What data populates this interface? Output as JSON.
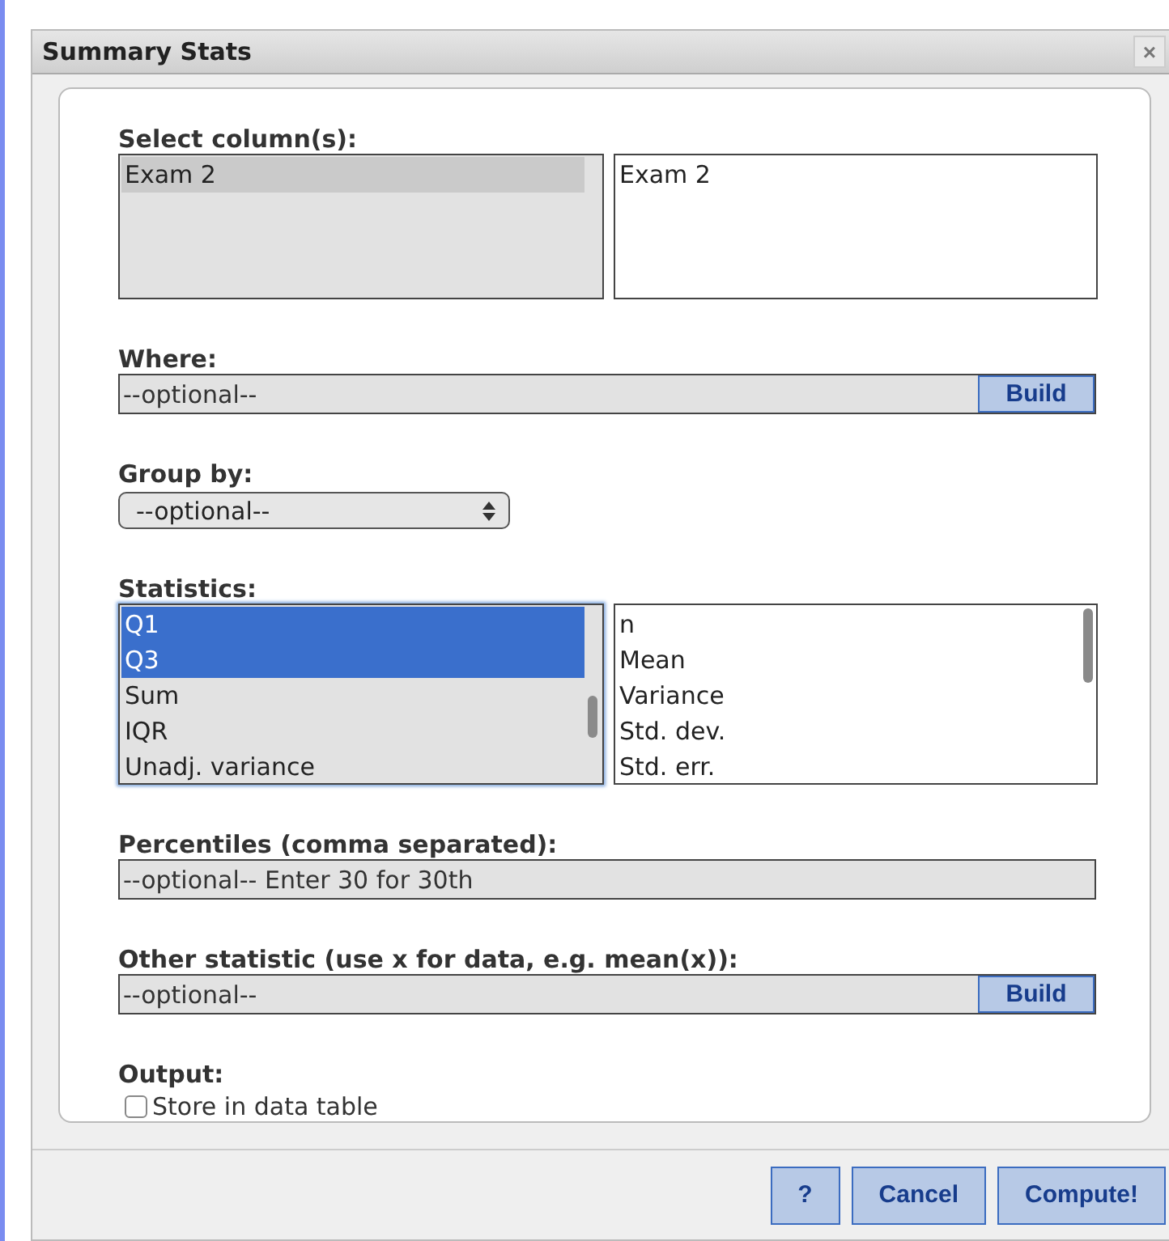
{
  "window": {
    "title": "Summary Stats",
    "close": "×"
  },
  "select_columns": {
    "label": "Select column(s):",
    "available": [
      {
        "label": "Exam 2",
        "selected": true
      }
    ],
    "chosen": [
      {
        "label": "Exam 2"
      }
    ]
  },
  "where": {
    "label": "Where:",
    "placeholder": "--optional--",
    "button": "Build"
  },
  "group_by": {
    "label": "Group by:",
    "value": "--optional--"
  },
  "statistics": {
    "label": "Statistics:",
    "available": [
      {
        "label": "Q1",
        "selected": true
      },
      {
        "label": "Q3",
        "selected": true
      },
      {
        "label": "Sum",
        "selected": false
      },
      {
        "label": "IQR",
        "selected": false
      },
      {
        "label": "Unadj. variance",
        "selected": false
      }
    ],
    "chosen": [
      {
        "label": "n"
      },
      {
        "label": "Mean"
      },
      {
        "label": "Variance"
      },
      {
        "label": "Std. dev."
      },
      {
        "label": "Std. err."
      }
    ]
  },
  "percentiles": {
    "label": "Percentiles (comma separated):",
    "placeholder": "--optional-- Enter 30 for 30th"
  },
  "other_statistic": {
    "label": "Other statistic (use x for data, e.g. mean(x)):",
    "placeholder": "--optional--",
    "button": "Build"
  },
  "output": {
    "label": "Output:",
    "store_in_table": {
      "label": "Store in data table",
      "checked": false
    }
  },
  "buttons": [
    "?",
    "Cancel",
    "Compute!"
  ]
}
